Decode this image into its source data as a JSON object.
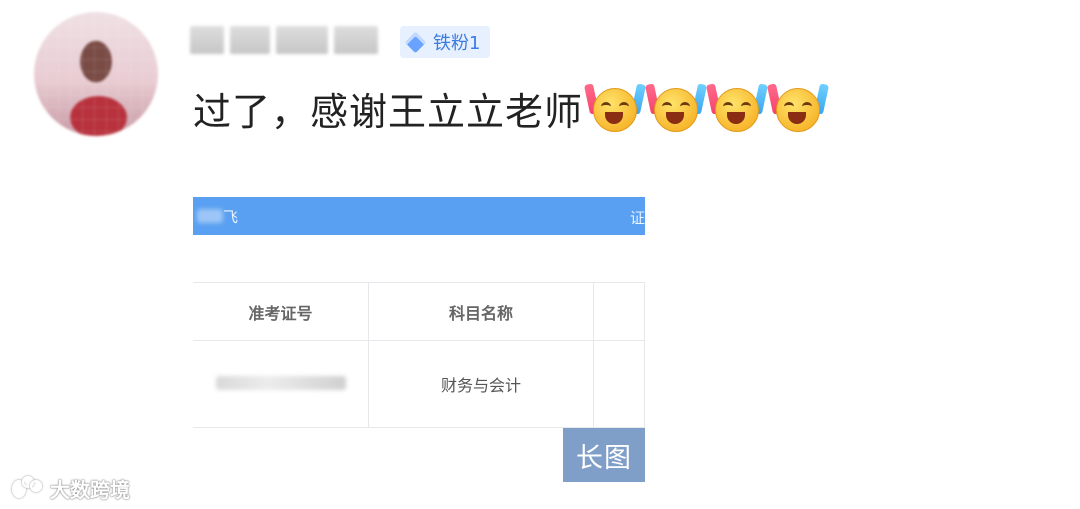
{
  "post": {
    "badge": "铁粉1",
    "comment": "过了，感谢王立立老师",
    "emojis": [
      "laughing-cheer-emoji",
      "laughing-cheer-emoji",
      "laughing-cheer-emoji",
      "laughing-cheer-emoji"
    ]
  },
  "screenshot": {
    "header_left": "飞",
    "header_right": "证",
    "columns": [
      "准考证号",
      "科目名称",
      ""
    ],
    "rows": [
      {
        "subject": "财务与会计"
      }
    ],
    "long_image_label": "长图"
  },
  "watermark": {
    "text": "大数跨境"
  },
  "colors": {
    "header_blue": "#5aa0f2",
    "badge_bg": "#e6f0ff",
    "badge_text": "#3c7be0",
    "long_image_bg": "#7f9fc9"
  }
}
